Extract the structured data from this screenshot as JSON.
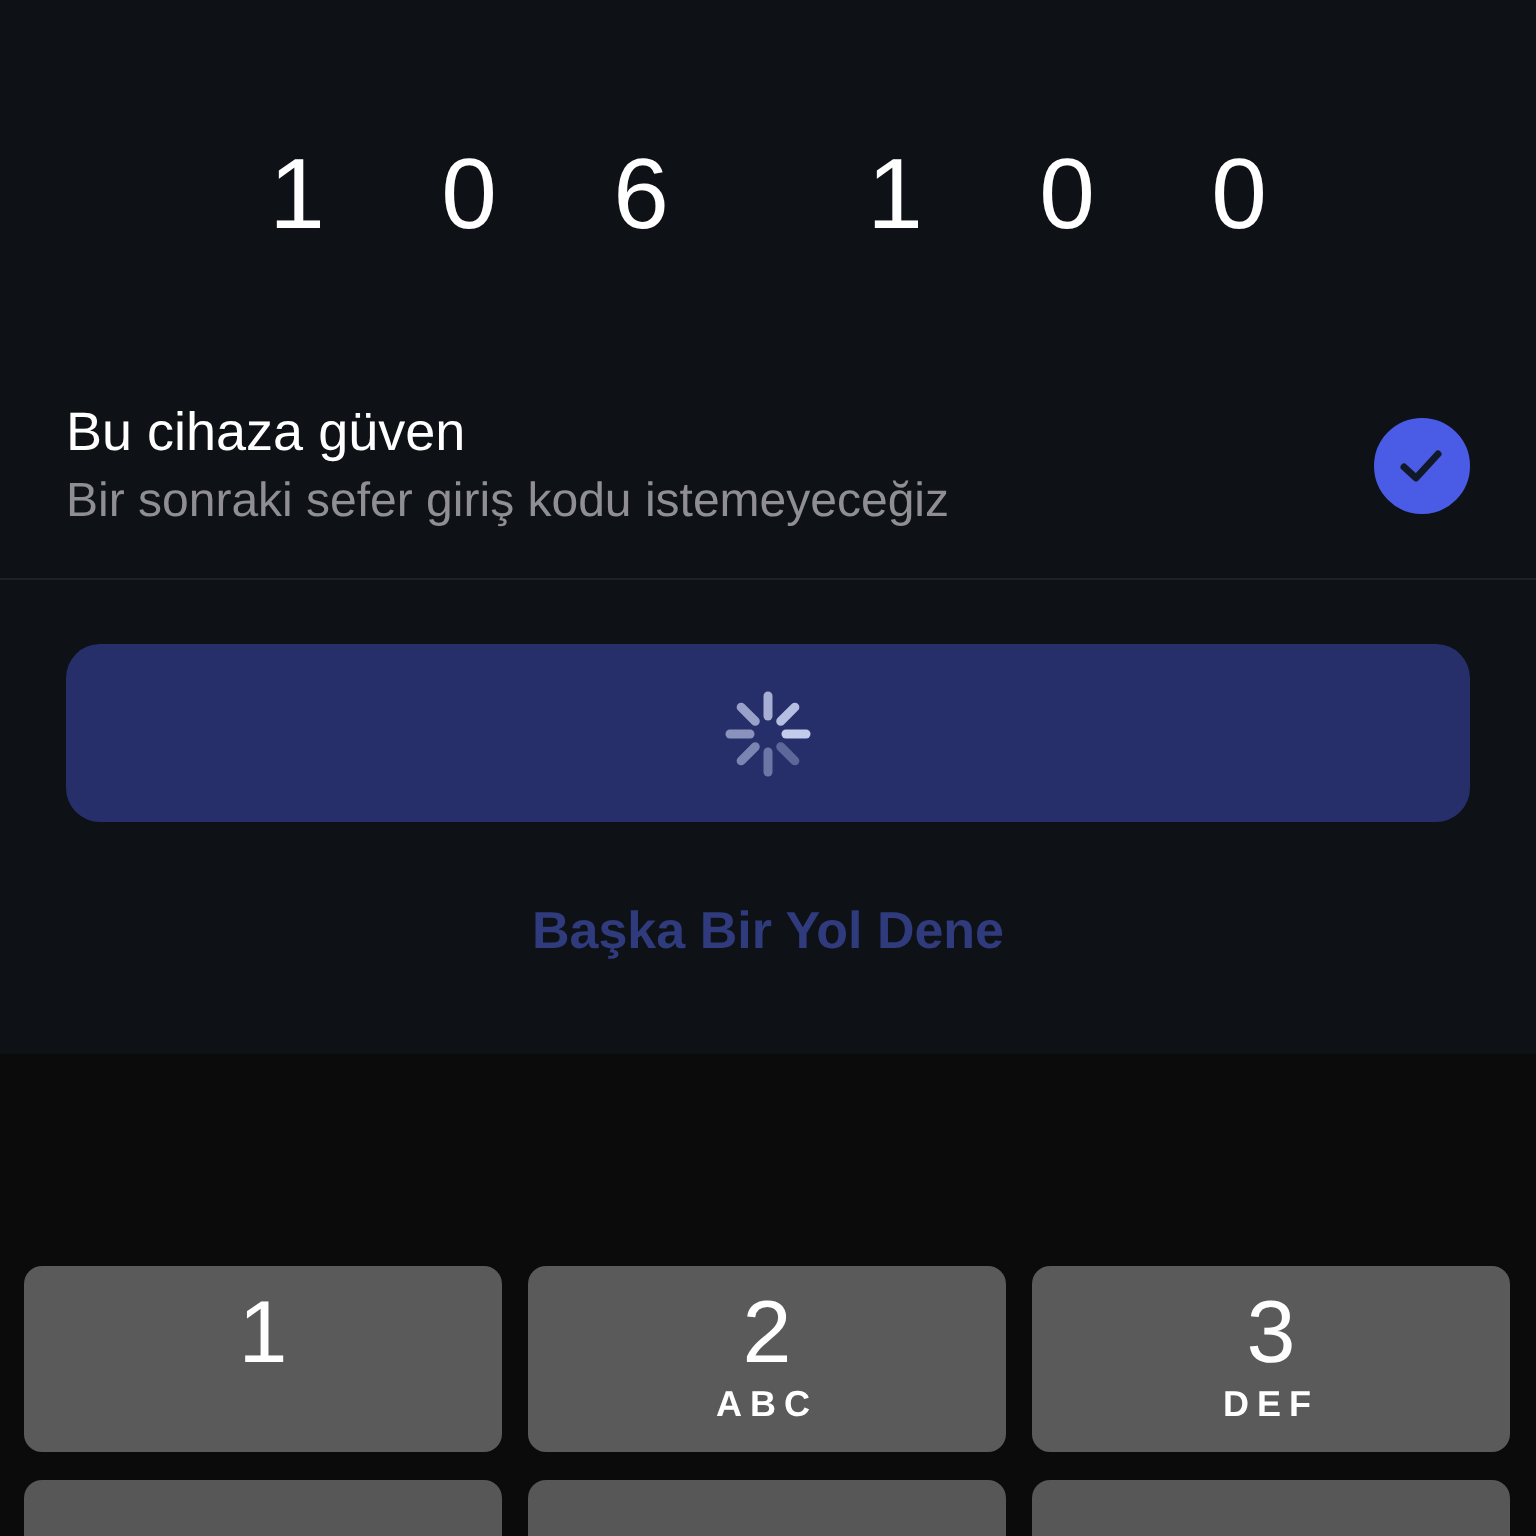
{
  "code": {
    "groups": [
      [
        "1",
        "0",
        "6"
      ],
      [
        "1",
        "0",
        "0"
      ]
    ]
  },
  "trust_device": {
    "title": "Bu cihaza güven",
    "subtitle": "Bir sonraki sefer giriş kodu istemeyeceğiz",
    "checked": true
  },
  "submit_button": {
    "loading": true
  },
  "alternative_link": "Başka Bir Yol Dene",
  "keypad": [
    {
      "kind": "full",
      "digit": "1"
    },
    {
      "kind": "full",
      "digit": "2",
      "letters": "ABC"
    },
    {
      "kind": "full",
      "digit": "3",
      "letters": "DEF"
    },
    {
      "kind": "cut"
    },
    {
      "kind": "cut"
    },
    {
      "kind": "cut"
    }
  ]
}
